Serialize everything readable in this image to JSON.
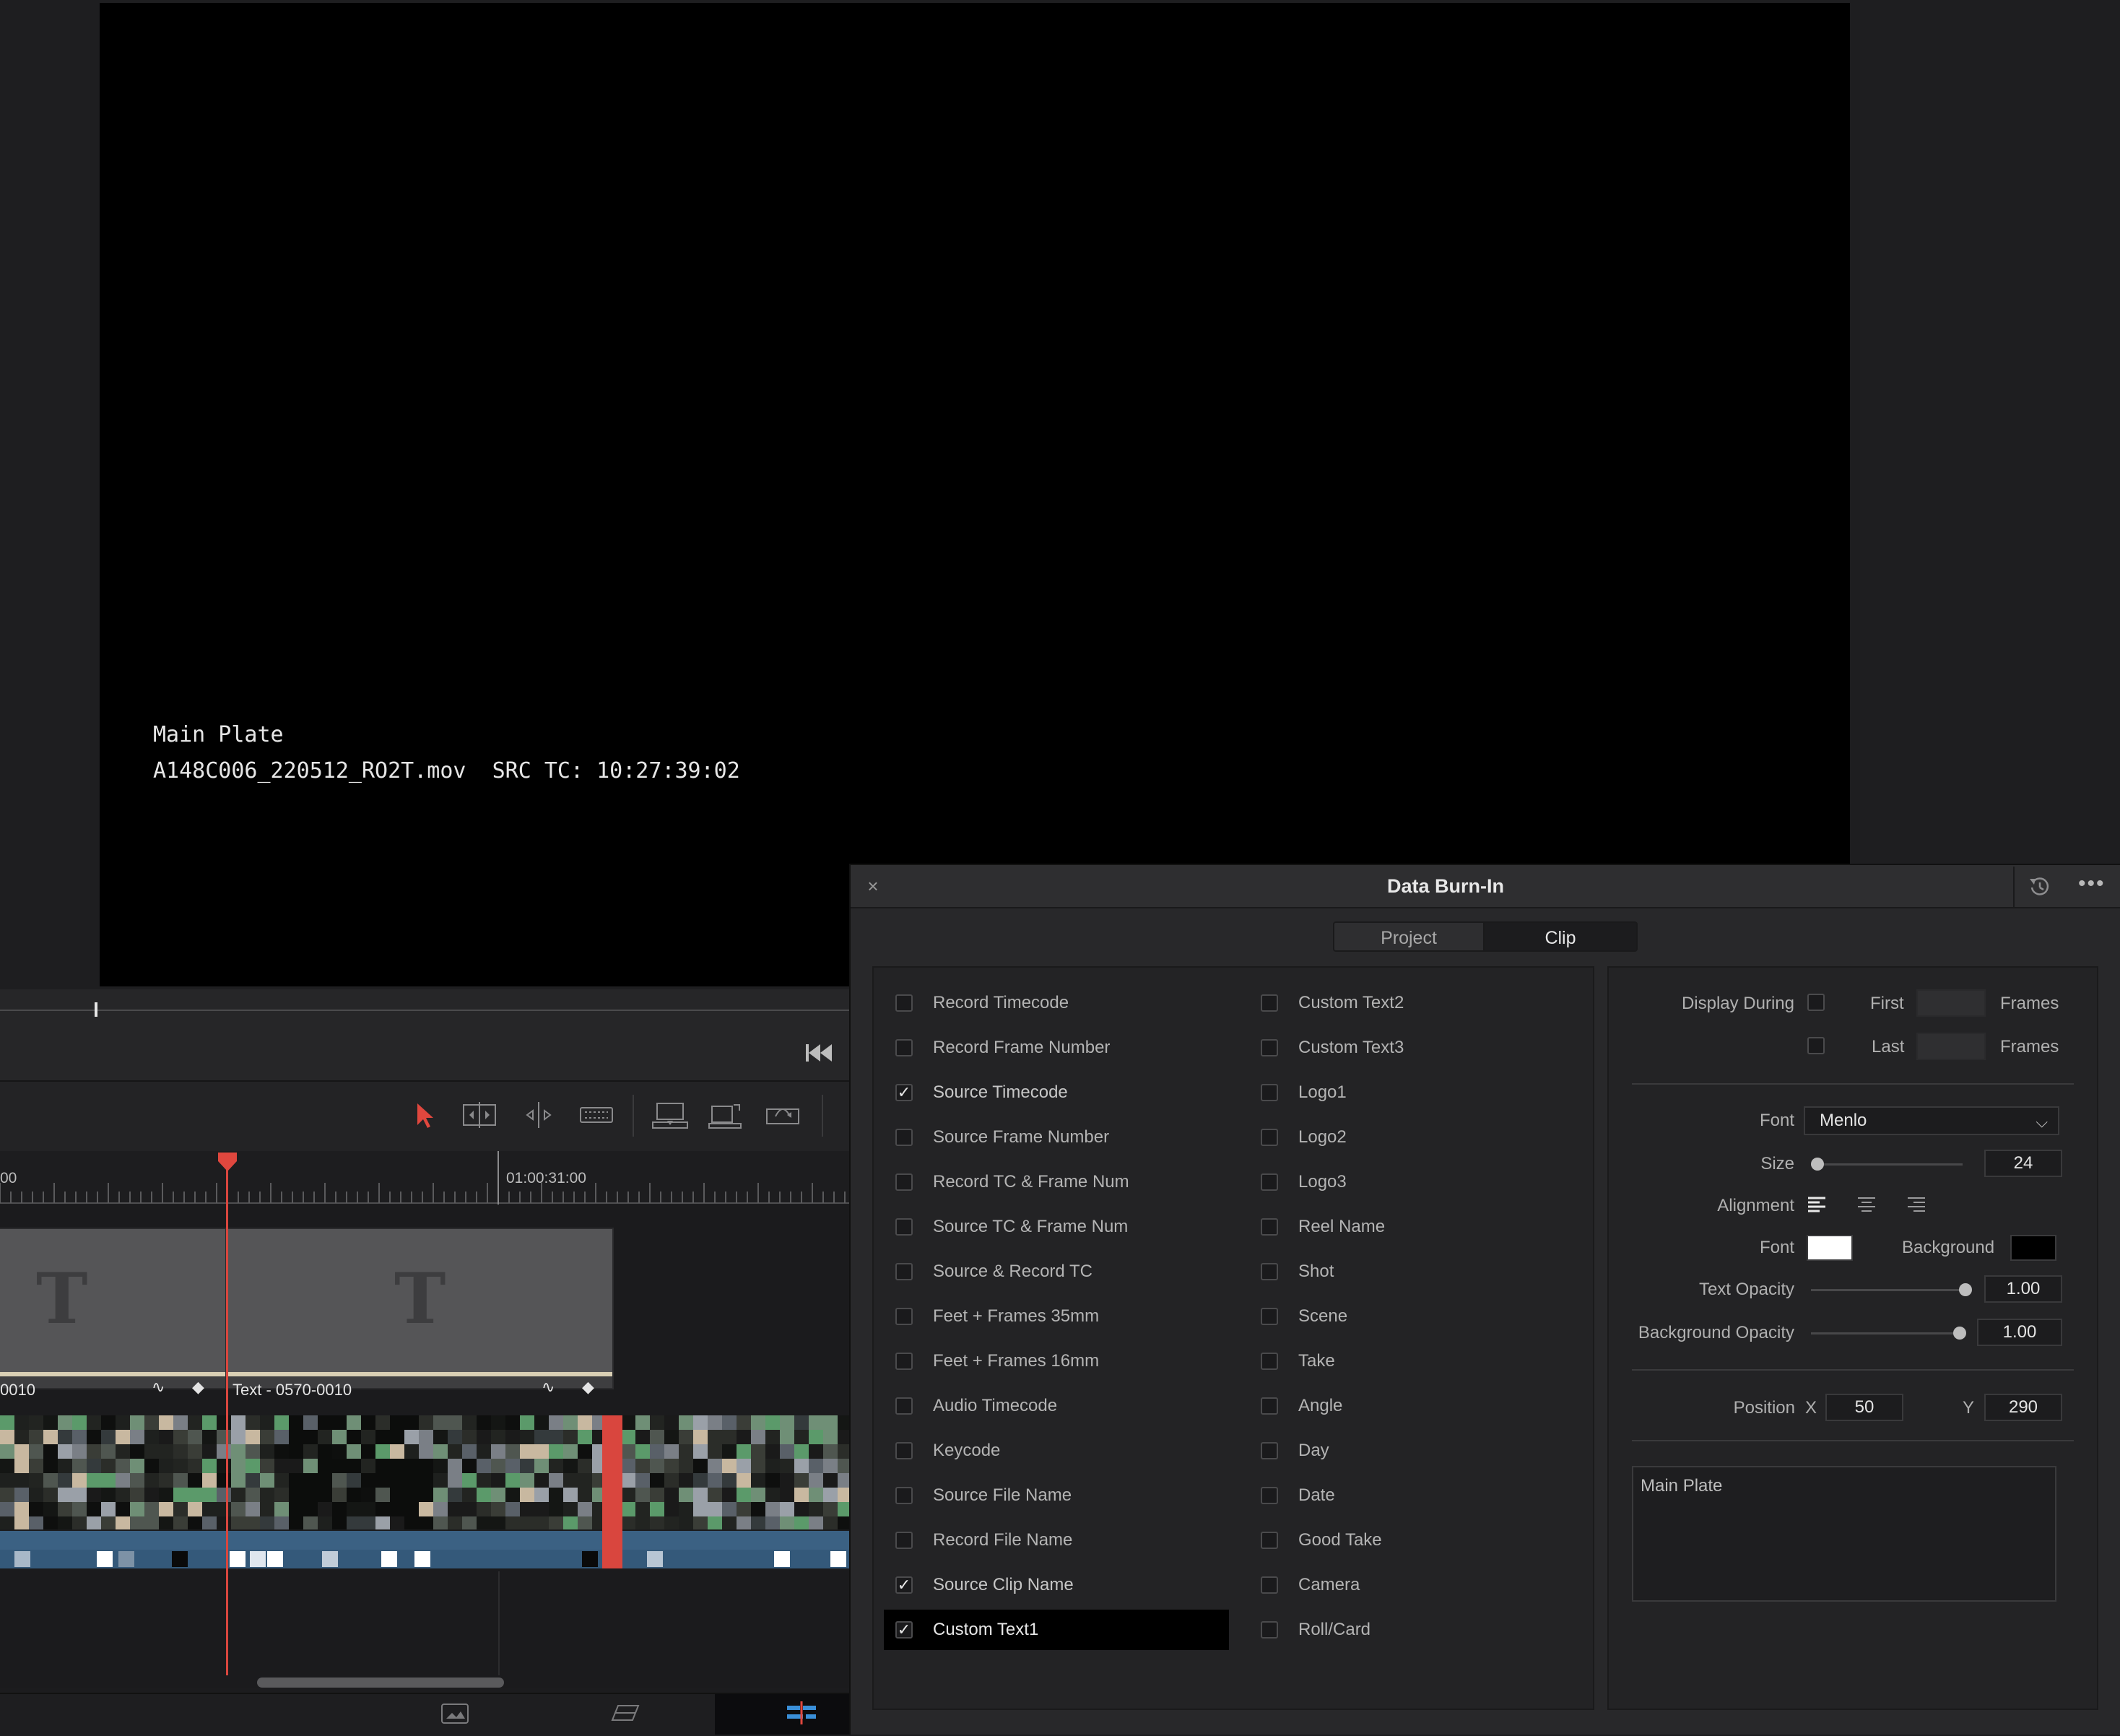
{
  "viewer": {
    "burn_in_lines": [
      "Main Plate",
      "A148C006_220512_RO2T.mov  SRC TC: 10:27:39:02"
    ]
  },
  "timeline": {
    "ruler_label": "01:00:31:00",
    "clips": [
      {
        "name": "0010",
        "glyph": "T"
      },
      {
        "name": "Text - 0570-0010",
        "glyph": "T"
      }
    ],
    "clip_controls": {
      "curve": "∿",
      "keyframe": "◆"
    }
  },
  "panel": {
    "title": "Data Burn-In",
    "close_glyph": "×",
    "more_glyph": "•••",
    "tabs": [
      {
        "label": "Project",
        "active": false
      },
      {
        "label": "Clip",
        "active": true
      }
    ],
    "left_column": [
      {
        "label": "Record Timecode",
        "checked": false
      },
      {
        "label": "Record Frame Number",
        "checked": false
      },
      {
        "label": "Source Timecode",
        "checked": true
      },
      {
        "label": "Source Frame Number",
        "checked": false
      },
      {
        "label": "Record TC & Frame Num",
        "checked": false
      },
      {
        "label": "Source TC & Frame Num",
        "checked": false
      },
      {
        "label": "Source & Record TC",
        "checked": false
      },
      {
        "label": "Feet + Frames 35mm",
        "checked": false
      },
      {
        "label": "Feet + Frames 16mm",
        "checked": false
      },
      {
        "label": "Audio Timecode",
        "checked": false
      },
      {
        "label": "Keycode",
        "checked": false
      },
      {
        "label": "Source File Name",
        "checked": false
      },
      {
        "label": "Record File Name",
        "checked": false
      },
      {
        "label": "Source Clip Name",
        "checked": true
      },
      {
        "label": "Custom Text1",
        "checked": true,
        "selected": true
      }
    ],
    "right_column": [
      {
        "label": "Custom Text2",
        "checked": false
      },
      {
        "label": "Custom Text3",
        "checked": false
      },
      {
        "label": "Logo1",
        "checked": false
      },
      {
        "label": "Logo2",
        "checked": false
      },
      {
        "label": "Logo3",
        "checked": false
      },
      {
        "label": "Reel Name",
        "checked": false
      },
      {
        "label": "Shot",
        "checked": false
      },
      {
        "label": "Scene",
        "checked": false
      },
      {
        "label": "Take",
        "checked": false
      },
      {
        "label": "Angle",
        "checked": false
      },
      {
        "label": "Day",
        "checked": false
      },
      {
        "label": "Date",
        "checked": false
      },
      {
        "label": "Good Take",
        "checked": false
      },
      {
        "label": "Camera",
        "checked": false
      },
      {
        "label": "Roll/Card",
        "checked": false
      }
    ],
    "props": {
      "display_during_label": "Display During",
      "first_label": "First",
      "last_label": "Last",
      "frames_label": "Frames",
      "font_label": "Font",
      "font_value": "Menlo",
      "size_label": "Size",
      "size_value": "24",
      "alignment_label": "Alignment",
      "font_color_label": "Font",
      "background_label": "Background",
      "font_color": "#ffffff",
      "background_color": "#000000",
      "text_opacity_label": "Text Opacity",
      "text_opacity_value": "1.00",
      "bg_opacity_label": "Background Opacity",
      "bg_opacity_value": "1.00",
      "position_label": "Position",
      "x_label": "X",
      "x_value": "50",
      "y_label": "Y",
      "y_value": "290",
      "custom_text": "Main Plate"
    }
  }
}
